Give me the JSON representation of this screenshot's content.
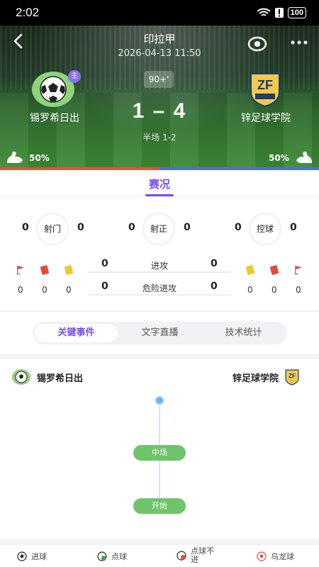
{
  "status_bar": {
    "time": "2:02",
    "battery": "100"
  },
  "header": {
    "league": "印拉甲",
    "datetime": "2026-04-13 11:50",
    "minute": "90+'",
    "score": "1 – 4",
    "halftime": "半场 1-2",
    "home": {
      "name": "锡罗希日出",
      "badge": "主",
      "possession": "50%"
    },
    "away": {
      "name": "锌足球学院",
      "possession": "50%"
    }
  },
  "possession_share": {
    "home": 0.5,
    "away": 0.5
  },
  "colors": {
    "accent": "#7a4cf0",
    "home": "#e2533d",
    "away": "#4e6fd6",
    "pill": "#6dc46a"
  },
  "tabs": {
    "main": "赛况"
  },
  "stats": [
    {
      "label": "射门",
      "home": "0",
      "away": "0"
    },
    {
      "label": "射正",
      "home": "0",
      "away": "0"
    },
    {
      "label": "控球",
      "home": "0",
      "away": "0"
    }
  ],
  "cards": {
    "home": {
      "corners": "0",
      "red": "0",
      "yellow": "0"
    },
    "away": {
      "yellow": "0",
      "red": "0",
      "corners": "0"
    }
  },
  "attacks": [
    {
      "label": "进攻",
      "home": "0",
      "away": "0"
    },
    {
      "label": "危险进攻",
      "home": "0",
      "away": "0"
    }
  ],
  "segments": [
    "关键事件",
    "文字直播",
    "技术统计"
  ],
  "timeline": {
    "home_name": "锡罗希日出",
    "away_name": "锌足球学院",
    "events": [
      "中场",
      "开始"
    ]
  },
  "legend": [
    "进球",
    "点球",
    "点球不进",
    "乌龙球"
  ],
  "icons": [
    "back-icon",
    "eye-icon",
    "more-icon",
    "wifi-icon",
    "alert-icon",
    "battery-icon",
    "flexed-arm-icon",
    "corner-flag-icon",
    "red-card-icon",
    "yellow-card-icon",
    "soccer-ball-icon"
  ]
}
